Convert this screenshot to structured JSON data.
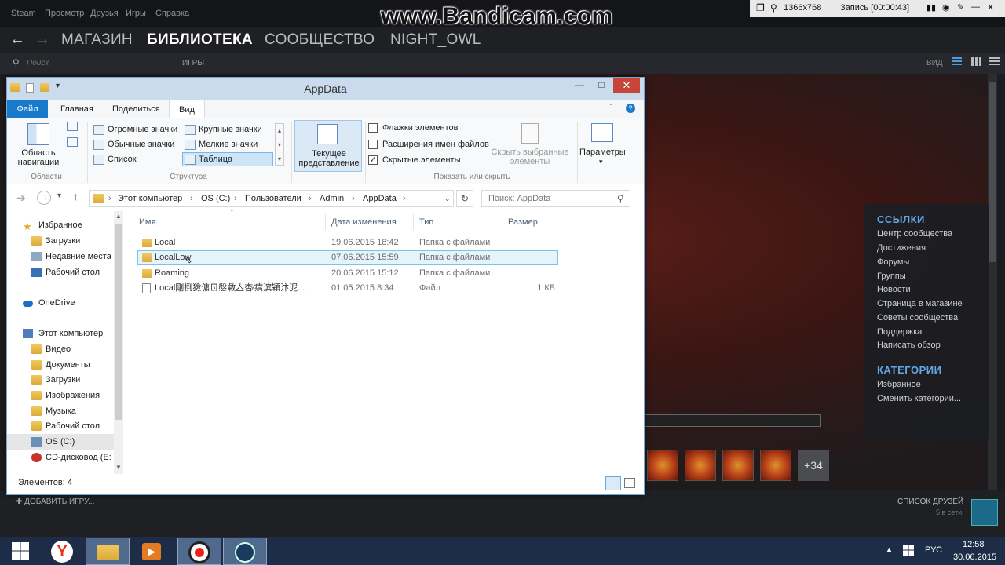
{
  "steam": {
    "menubar": [
      "Steam",
      "Просмотр",
      "Друзья",
      "Игры",
      "Справка"
    ],
    "nav": {
      "store": "МАГАЗИН",
      "library": "БИБЛИОТЕКА",
      "community": "СООБЩЕСТВО",
      "user": "NIGHT_OWL"
    },
    "search_placeholder": "Поиск",
    "games_label": "ИГРЫ",
    "view_label": "ВИД",
    "links_heading": "ССЫЛКИ",
    "links": [
      "Центр сообщества",
      "Достижения",
      "Форумы",
      "Группы",
      "Новости",
      "Страница в магазине",
      "Советы сообщества",
      "Поддержка",
      "Написать обзор"
    ],
    "categories_heading": "КАТЕГОРИИ",
    "categories": [
      "Избранное",
      "Сменить категории..."
    ],
    "more_count": "+34",
    "add_game": "ДОБАВИТЬ ИГРУ...",
    "friends_list": "СПИСОК ДРУЗЕЙ",
    "friends_online": "5 в сети"
  },
  "watermark": "www.Bandicam.com",
  "recorder": {
    "resolution": "1366x768",
    "status": "Запись [00:00:43]"
  },
  "explorer": {
    "title": "AppData",
    "tabs": [
      "Файл",
      "Главная",
      "Поделиться",
      "Вид"
    ],
    "ribbon": {
      "nav_pane": "Область навигации",
      "areas": "Области",
      "layouts": [
        "Огромные значки",
        "Крупные значки",
        "Обычные значки",
        "Мелкие значки",
        "Список",
        "Таблица"
      ],
      "structure": "Структура",
      "current_view": "Текущее представление",
      "checks": [
        {
          "label": "Флажки элементов",
          "checked": false
        },
        {
          "label": "Расширения имен файлов",
          "checked": false
        },
        {
          "label": "Скрытые элементы",
          "checked": true
        }
      ],
      "hide_selected": "Скрыть выбранные элементы",
      "show_hide": "Показать или скрыть",
      "options": "Параметры"
    },
    "path": [
      "Этот компьютер",
      "OS (C:)",
      "Пользователи",
      "Admin",
      "AppData"
    ],
    "search_placeholder": "Поиск: AppData",
    "nav": {
      "favorites": "Избранное",
      "fav_items": [
        "Загрузки",
        "Недавние места",
        "Рабочий стол"
      ],
      "onedrive": "OneDrive",
      "this_pc": "Этот компьютер",
      "pc_items": [
        "Видео",
        "Документы",
        "Загрузки",
        "Изображения",
        "Музыка",
        "Рабочий стол",
        "OS (C:)",
        "CD-дисковод (E:"
      ]
    },
    "columns": [
      "Имя",
      "Дата изменения",
      "Тип",
      "Размер"
    ],
    "files": [
      {
        "name": "Local",
        "date": "19.06.2015 18:42",
        "type": "Папка с файлами",
        "size": ""
      },
      {
        "name": "LocalLow",
        "date": "07.06.2015 15:59",
        "type": "Папка с файлами",
        "size": ""
      },
      {
        "name": "Roaming",
        "date": "20.06.2015 15:12",
        "type": "Папка с файлами",
        "size": ""
      },
      {
        "name": "Local剛捯獫傭ㄖ慇敹亼杏⁄㾸滨㯋汴泥...",
        "date": "01.05.2015 8:34",
        "type": "Файл",
        "size": "1 КБ"
      }
    ],
    "status": "Элементов: 4"
  },
  "taskbar": {
    "lang": "РУС",
    "time": "12:58",
    "date": "30.06.2015"
  }
}
